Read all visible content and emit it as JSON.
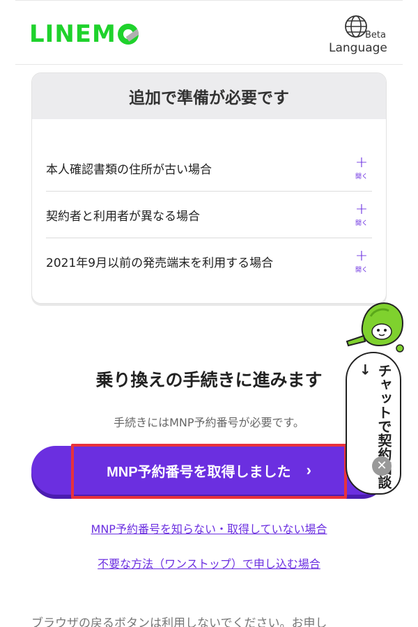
{
  "header": {
    "logo": "LINEMO",
    "language_label": "Language",
    "language_badge": "Beta"
  },
  "card": {
    "title": "追加で準備が必要です",
    "items": [
      {
        "label": "本人確認書類の住所が古い場合",
        "toggle": "開く"
      },
      {
        "label": "契約者と利用者が異なる場合",
        "toggle": "開く"
      },
      {
        "label": "2021年9月以前の発売端末を利用する場合",
        "toggle": "開く"
      }
    ]
  },
  "procedure": {
    "title": "乗り換えの手続きに進みます",
    "subtitle": "手続きにはMNP予約番号が必要です。",
    "primary_button": "MNP予約番号を取得しました",
    "link_no_number": "MNP予約番号を知らない・取得していない場合",
    "link_unneeded": "不要な方法（ワンストップ）で申し込む場合"
  },
  "footer": {
    "note": "ブラウザの戻るボタンは利用しないでください。お申し"
  },
  "chat": {
    "label": "チャットで契約相談→",
    "close_symbol": "✕"
  },
  "colors": {
    "brand_green": "#1fd22c",
    "accent_purple": "#6b2fe0",
    "highlight_red": "#e8323c"
  }
}
